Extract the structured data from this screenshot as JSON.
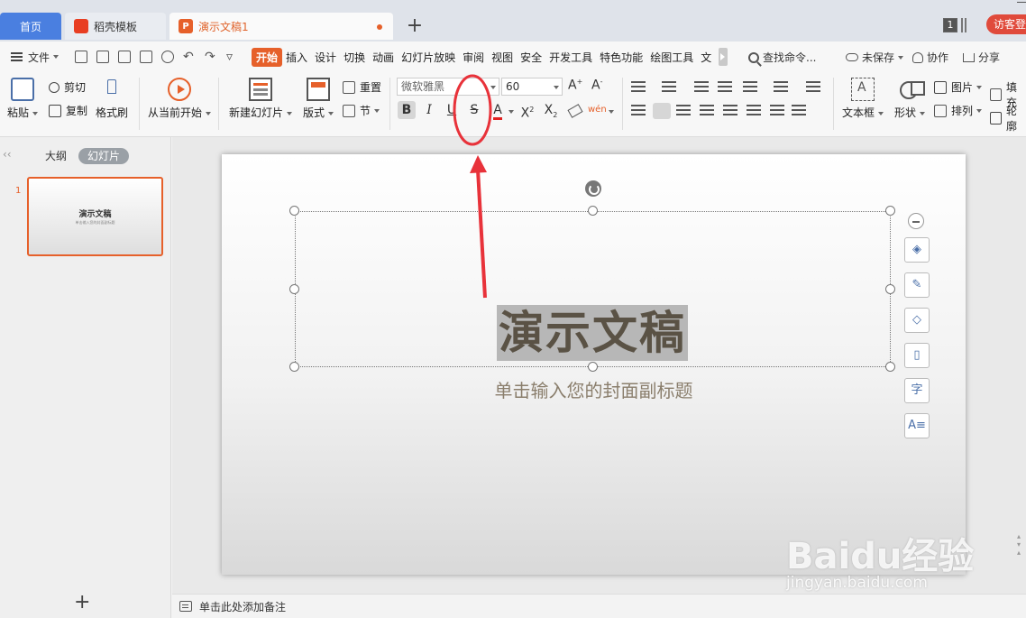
{
  "tabs": {
    "home": "首页",
    "template": "稻壳模板",
    "document": "演示文稿1",
    "guest_login": "访客登",
    "window_count": "1"
  },
  "menu": {
    "file": "文件",
    "tabs": [
      "开始",
      "插入",
      "设计",
      "切换",
      "动画",
      "幻灯片放映",
      "审阅",
      "视图",
      "安全",
      "开发工具",
      "特色功能",
      "绘图工具",
      "文"
    ],
    "search": "查找命令...",
    "unsaved": "未保存",
    "collab": "协作",
    "share": "分享"
  },
  "ribbon": {
    "paste": "粘贴",
    "cut": "剪切",
    "copy": "复制",
    "format_painter": "格式刷",
    "play_from_current": "从当前开始",
    "new_slide": "新建幻灯片",
    "layout": "版式",
    "reset": "重置",
    "section": "节",
    "font_name": "微软雅黑",
    "font_size": "60",
    "bold": "B",
    "italic": "I",
    "underline": "U",
    "strikethrough": "S",
    "font_color": "A",
    "phonetic": "wén",
    "text_box": "文本框",
    "shape": "形状",
    "picture": "图片",
    "arrange": "排列",
    "fill": "填充",
    "outline": "轮廓"
  },
  "left_panel": {
    "outline_tab": "大纲",
    "slides_tab": "幻灯片",
    "slide_number": "1",
    "thumb_title": "演示文稿",
    "thumb_subtitle": "单击输入您的封面副标题"
  },
  "slide": {
    "title": "演示文稿",
    "subtitle": "单击输入您的封面副标题"
  },
  "notes": {
    "placeholder": "单击此处添加备注"
  },
  "watermark": {
    "logo": "Baidu经验",
    "url": "jingyan.baidu.com"
  },
  "colors": {
    "accent": "#e6602a",
    "home_tab": "#4a7fe0",
    "annotation": "#e8323a"
  }
}
